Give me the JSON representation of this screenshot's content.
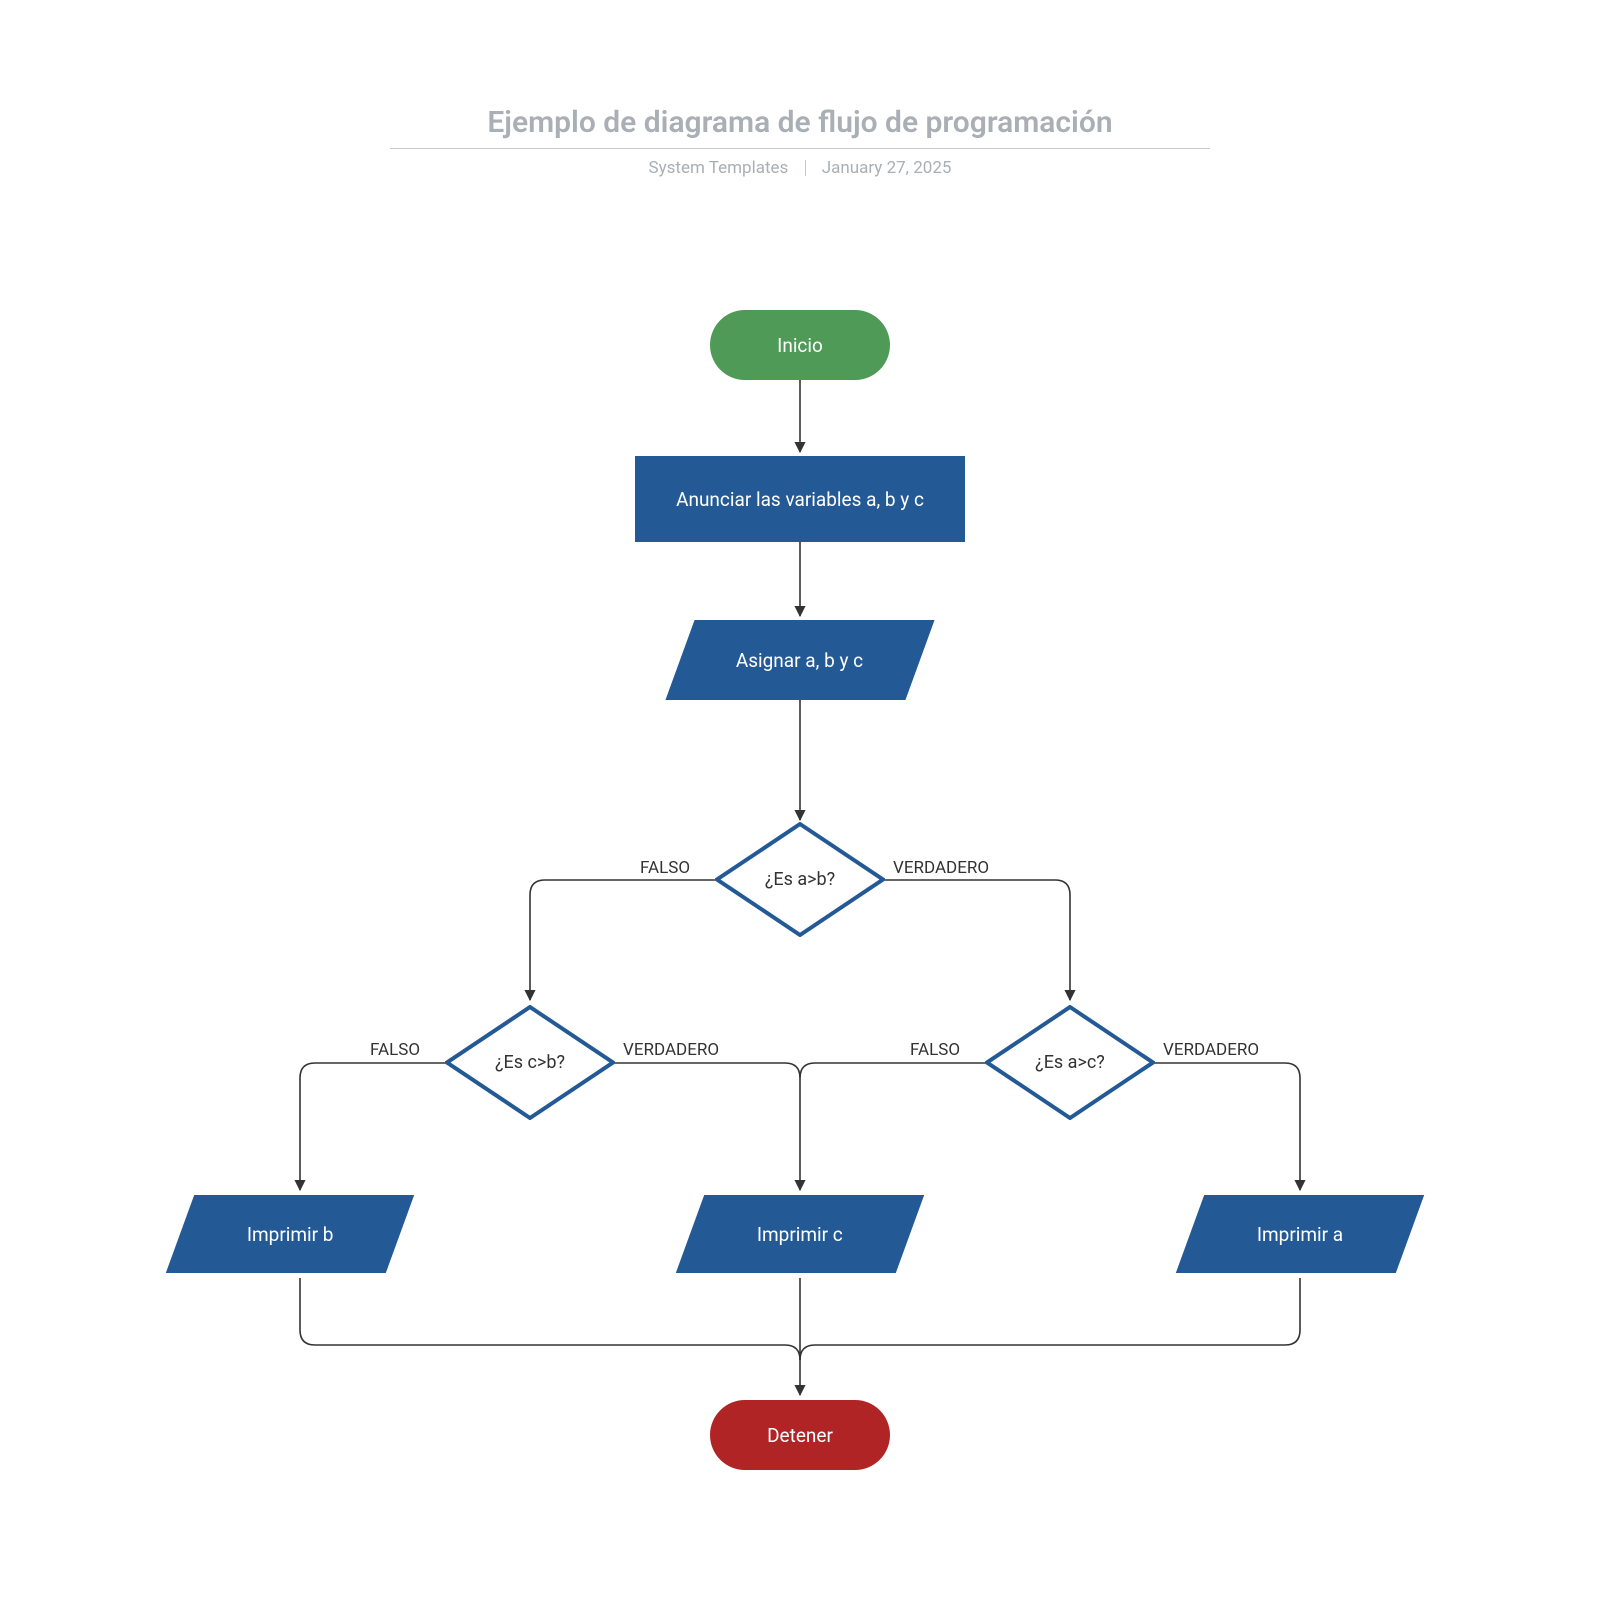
{
  "header": {
    "title": "Ejemplo de diagrama de flujo de programación",
    "author": "System Templates",
    "date": "January 27, 2025"
  },
  "nodes": {
    "start": "Inicio",
    "declare": "Anunciar las variables a, b y c",
    "assign": "Asignar a, b y c",
    "dec_ab": "¿Es a>b?",
    "dec_cb": "¿Es c>b?",
    "dec_ac": "¿Es a>c?",
    "print_b": "Imprimir b",
    "print_c": "Imprimir c",
    "print_a": "Imprimir a",
    "stop": "Detener"
  },
  "labels": {
    "true": "VERDADERO",
    "false": "FALSO"
  },
  "colors": {
    "start": "#4f9a56",
    "blue": "#235a95",
    "stop": "#b02425",
    "stroke": "#333333"
  }
}
